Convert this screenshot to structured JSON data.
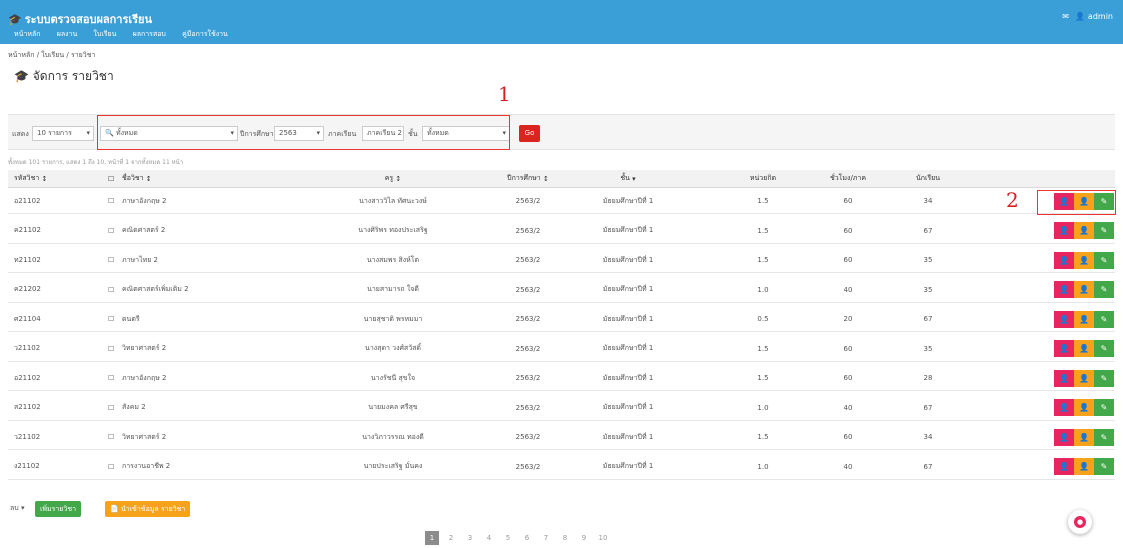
{
  "app": {
    "title": "ระบบตรวจสอบผลการเรียน",
    "user": "admin",
    "nav": [
      "หน้าหลัก",
      "ผลงาน",
      "ใบเรียน",
      "ผลการสอบ",
      "คู่มือการใช้งาน"
    ]
  },
  "breadcrumb": "หน้าหลัก / ใบเรียน / รายวิชา",
  "page_title": "จัดการ รายวิชา",
  "filters": {
    "show_label": "แสดง",
    "show_value": "10 รายการ",
    "search_value": "ทั้งหมด",
    "year_label": "ปีการศึกษา",
    "year_value": "2563",
    "term_label": "ภาคเรียน",
    "term_value": "ภาคเรียน 2",
    "level_label": "ชั้น",
    "level_value": "ทั้งหมด",
    "go_label": "Go"
  },
  "info_text": "ทั้งหมด 101 รายการ, แสดง 1 ถึง 10, หน้าที่ 1 จากทั้งหมด 11 หน้า",
  "table": {
    "headers": {
      "code": "รหัสวิชา",
      "name": "ชื่อวิชา",
      "teacher": "ครู",
      "term": "ปีการศึกษา",
      "level": "ชั้น",
      "credit": "หน่วยกิต",
      "hours": "ชั่วโมง/ภาค",
      "enrolled": "นักเรียน"
    },
    "rows": [
      {
        "code": "อ21102",
        "name": "ภาษาอังกฤษ 2",
        "teacher": "นางสาววิไล ทัศนะวงษ์",
        "term": "2563/2",
        "level": "มัธยมศึกษาปีที่ 1",
        "credit": "1.5",
        "hours": "60",
        "enrolled": "34"
      },
      {
        "code": "ค21102",
        "name": "คณิตศาสตร์ 2",
        "teacher": "นางศิริพร ทองประเสริฐ",
        "term": "2563/2",
        "level": "มัธยมศึกษาปีที่ 1",
        "credit": "1.5",
        "hours": "60",
        "enrolled": "67"
      },
      {
        "code": "ท21102",
        "name": "ภาษาไทย 2",
        "teacher": "นางสมพร สิงห์โต",
        "term": "2563/2",
        "level": "มัธยมศึกษาปีที่ 1",
        "credit": "1.5",
        "hours": "60",
        "enrolled": "35"
      },
      {
        "code": "ค21202",
        "name": "คณิตศาสตร์เพิ่มเติม 2",
        "teacher": "นายสามารถ ใจดี",
        "term": "2563/2",
        "level": "มัธยมศึกษาปีที่ 1",
        "credit": "1.0",
        "hours": "40",
        "enrolled": "35"
      },
      {
        "code": "ศ21104",
        "name": "ดนตรี",
        "teacher": "นายสุชาติ พรหมมา",
        "term": "2563/2",
        "level": "มัธยมศึกษาปีที่ 1",
        "credit": "0.5",
        "hours": "20",
        "enrolled": "67"
      },
      {
        "code": "ว21102",
        "name": "วิทยาศาสตร์ 2",
        "teacher": "นางสุดา วงศ์สวัสดิ์",
        "term": "2563/2",
        "level": "มัธยมศึกษาปีที่ 1",
        "credit": "1.5",
        "hours": "60",
        "enrolled": "35"
      },
      {
        "code": "อ21102",
        "name": "ภาษาอังกฤษ 2",
        "teacher": "นางรัชนี สุขใจ",
        "term": "2563/2",
        "level": "มัธยมศึกษาปีที่ 1",
        "credit": "1.5",
        "hours": "60",
        "enrolled": "28"
      },
      {
        "code": "ส21102",
        "name": "สังคม 2",
        "teacher": "นายมงคล ศรีสุข",
        "term": "2563/2",
        "level": "มัธยมศึกษาปีที่ 1",
        "credit": "1.0",
        "hours": "40",
        "enrolled": "67"
      },
      {
        "code": "ว21102",
        "name": "วิทยาศาสตร์ 2",
        "teacher": "นางวิภาวรรณ ทองดี",
        "term": "2563/2",
        "level": "มัธยมศึกษาปีที่ 1",
        "credit": "1.5",
        "hours": "60",
        "enrolled": "34"
      },
      {
        "code": "ง21102",
        "name": "การงานอาชีพ 2",
        "teacher": "นายประเสริฐ มั่นคง",
        "term": "2563/2",
        "level": "มัธยมศึกษาปีที่ 1",
        "credit": "1.0",
        "hours": "40",
        "enrolled": "67"
      }
    ]
  },
  "bottom": {
    "select_label": "ลบ",
    "add_label": "เพิ่มรายวิชา",
    "import_label": "นำเข้าข้อมูล รายวิชา"
  },
  "pager": [
    "1",
    "2",
    "3",
    "4",
    "5",
    "6",
    "7",
    "8",
    "9",
    "10"
  ],
  "annotations": {
    "one": "1",
    "two": "2"
  },
  "icons": {
    "brand": "graduation-cap-icon",
    "edit": "pencil-icon",
    "view": "user-icon",
    "fab": "chat-icon"
  },
  "colors": {
    "header": "#3a9fd6",
    "danger": "#e8255f",
    "warning": "#f6a21a",
    "success": "#43a84a",
    "go": "#d9251d"
  }
}
